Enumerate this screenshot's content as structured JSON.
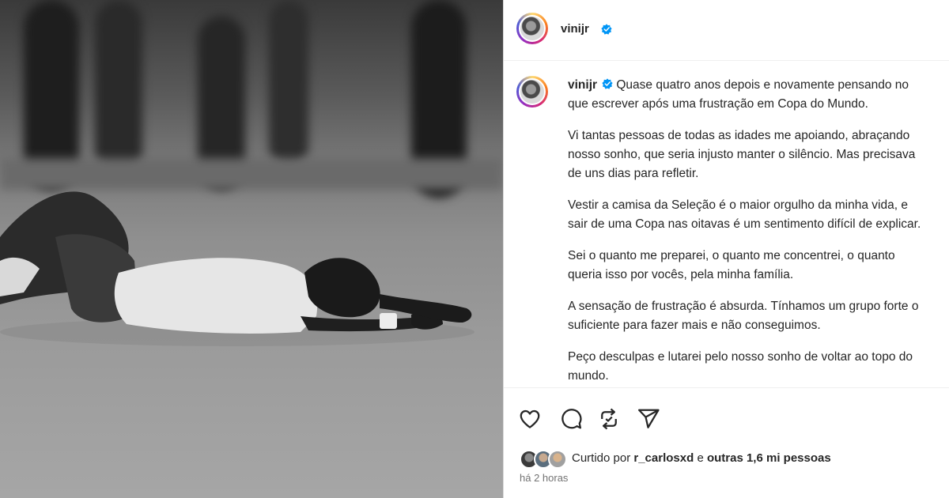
{
  "post": {
    "author": "vinijr",
    "caption_lines": {
      "p1l1": "Quase quatro anos depois e novamente pensando no",
      "p1l2": "que escrever após uma frustração em Copa do Mundo.",
      "p2l1": "Vi tantas pessoas de todas as idades me apoiando, abraçando",
      "p2l2": "nosso sonho, que seria injusto manter o silêncio. Mas precisava",
      "p2l3": "de uns dias para refletir.",
      "p3l1": "Vestir a camisa da Seleção é o maior orgulho da minha vida, e",
      "p3l2": "sair de uma Copa nas oitavas é um sentimento difícil de explicar.",
      "p4l1": "Sei o quanto me preparei, o quanto me concentrei, o quanto",
      "p4l2": "queria isso por vocês, pela minha família.",
      "p5l1": "A sensação de frustração é absurda. Tínhamos um grupo forte o",
      "p5l2": "suficiente para fazer mais e não conseguimos.",
      "p6l1": "Peço desculpas e lutarei pelo nosso sonho de voltar ao topo do",
      "p6l2": "mundo."
    },
    "likes": {
      "prefix": "Curtido por",
      "user": "r_carlosxd",
      "conj": "e",
      "others": "outras 1,6 mi pessoas"
    },
    "time": "há 2 horas"
  },
  "icons": {
    "like": "heart-icon",
    "comment": "comment-icon",
    "repost": "repost-icon",
    "share": "send-icon",
    "verified": "verified-badge-icon"
  },
  "colors": {
    "verified": "#0095f6",
    "text": "#262626",
    "muted": "#737373"
  }
}
